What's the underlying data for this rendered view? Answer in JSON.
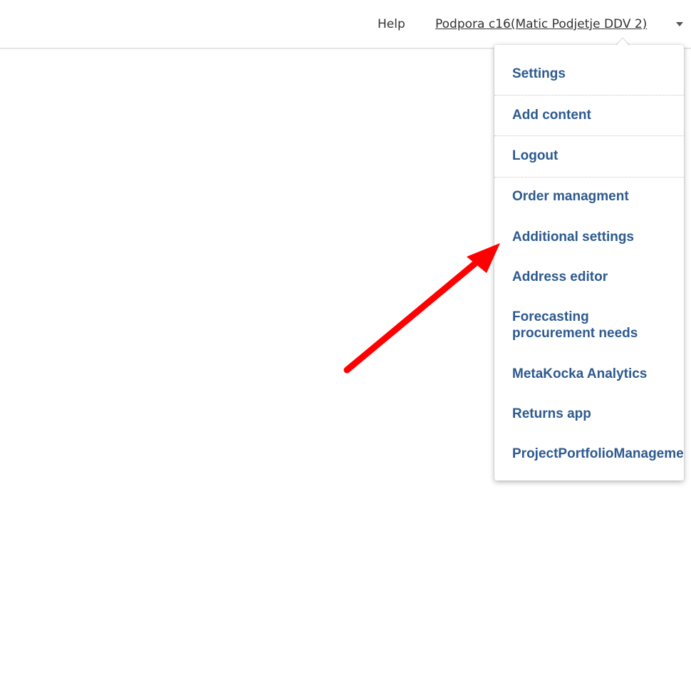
{
  "header": {
    "help_label": "Help",
    "user_label": "Podpora c16(Matic Podjetje DDV 2)"
  },
  "user_menu": {
    "items": [
      {
        "label": "Settings"
      },
      {
        "label": "Add content"
      },
      {
        "label": "Logout"
      },
      {
        "label": "Order managment"
      },
      {
        "label": "Additional settings"
      },
      {
        "label": "Address editor"
      },
      {
        "label": "Forecasting procurement needs"
      },
      {
        "label": "MetaKocka Analytics"
      },
      {
        "label": "Returns app"
      },
      {
        "label": "ProjectPortfolioManagement"
      }
    ]
  },
  "annotation": {
    "arrow_color": "#ff0000"
  },
  "colors": {
    "menu_link": "#2d5a8f",
    "header_text": "#333333"
  }
}
